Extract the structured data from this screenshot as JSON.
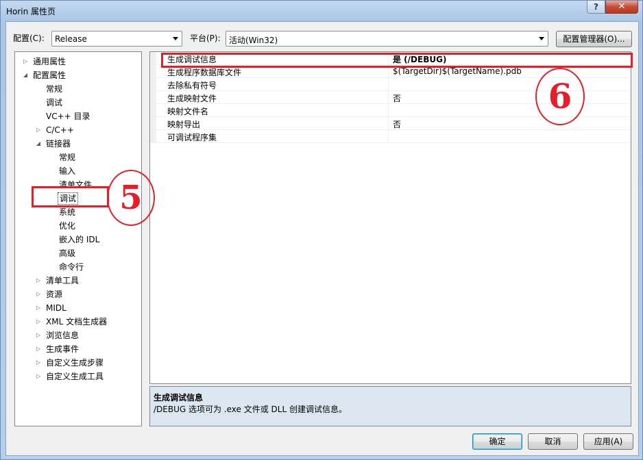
{
  "window": {
    "title": "Horin 属性页",
    "help_label": "?",
    "close_label": "✕"
  },
  "toolbar": {
    "config_label": "配置(C):",
    "config_value": "Release",
    "platform_label": "平台(P):",
    "platform_value": "活动(Win32)",
    "config_manager_label": "配置管理器(O)..."
  },
  "tree": {
    "items": [
      {
        "label": "通用属性",
        "expander": "▷"
      },
      {
        "label": "配置属性",
        "expander": "◢"
      },
      {
        "label": "常规",
        "expander": ""
      },
      {
        "label": "调试",
        "expander": ""
      },
      {
        "label": "VC++ 目录",
        "expander": ""
      },
      {
        "label": "C/C++",
        "expander": "▷"
      },
      {
        "label": "链接器",
        "expander": "◢"
      },
      {
        "label": "常规",
        "expander": ""
      },
      {
        "label": "输入",
        "expander": ""
      },
      {
        "label": "清单文件",
        "expander": ""
      },
      {
        "label": "调试",
        "expander": "",
        "selected": true
      },
      {
        "label": "系统",
        "expander": ""
      },
      {
        "label": "优化",
        "expander": ""
      },
      {
        "label": "嵌入的 IDL",
        "expander": ""
      },
      {
        "label": "高级",
        "expander": ""
      },
      {
        "label": "命令行",
        "expander": ""
      },
      {
        "label": "清单工具",
        "expander": "▷"
      },
      {
        "label": "资源",
        "expander": "▷"
      },
      {
        "label": "MIDL",
        "expander": "▷"
      },
      {
        "label": "XML 文档生成器",
        "expander": "▷"
      },
      {
        "label": "浏览信息",
        "expander": "▷"
      },
      {
        "label": "生成事件",
        "expander": "▷"
      },
      {
        "label": "自定义生成步骤",
        "expander": "▷"
      },
      {
        "label": "自定义生成工具",
        "expander": "▷"
      }
    ]
  },
  "properties": [
    {
      "name": "生成调试信息",
      "value": "是 (/DEBUG)"
    },
    {
      "name": "生成程序数据库文件",
      "value": "$(TargetDir)$(TargetName).pdb"
    },
    {
      "name": "去除私有符号",
      "value": ""
    },
    {
      "name": "生成映射文件",
      "value": "否"
    },
    {
      "name": "映射文件名",
      "value": ""
    },
    {
      "name": "映射导出",
      "value": "否"
    },
    {
      "name": "可调试程序集",
      "value": ""
    }
  ],
  "description": {
    "title": "生成调试信息",
    "text": "/DEBUG 选项可为 .exe 文件或 DLL 创建调试信息。"
  },
  "annotations": {
    "step5": "5",
    "step6": "6",
    "color": "#e3202a"
  },
  "buttons": {
    "ok": "确定",
    "cancel": "取消",
    "apply": "应用(A)"
  }
}
